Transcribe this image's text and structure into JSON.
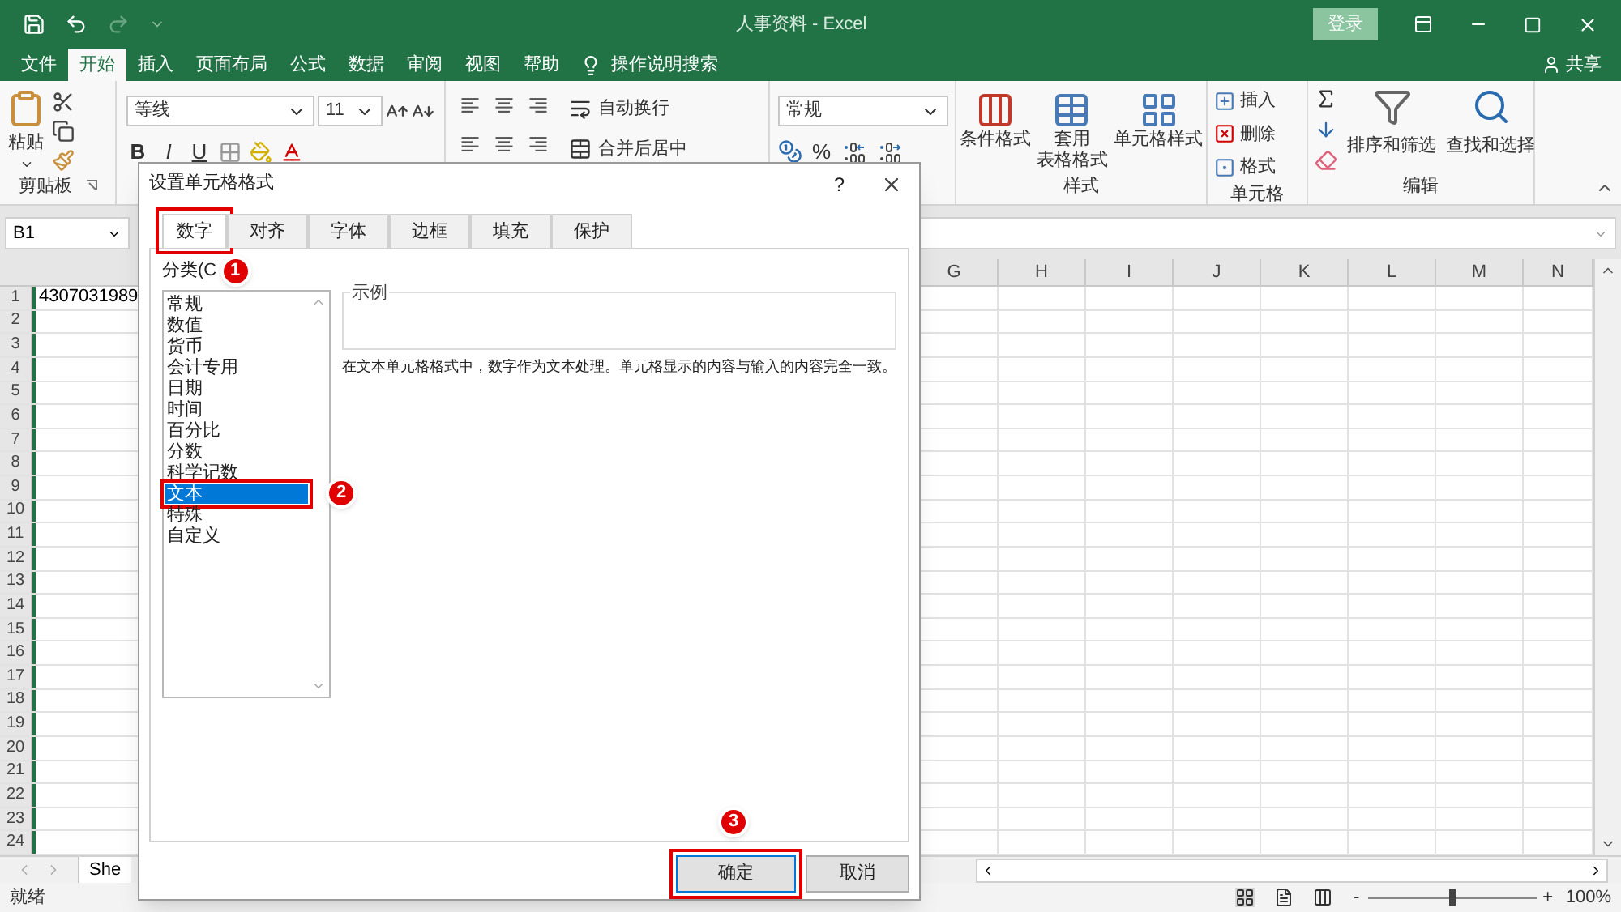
{
  "title_bar": {
    "title": "人事资料 - Excel",
    "sign_in": "登录"
  },
  "menu_tabs": [
    {
      "label": "文件",
      "selected": false
    },
    {
      "label": "开始",
      "selected": true
    },
    {
      "label": "插入",
      "selected": false
    },
    {
      "label": "页面布局",
      "selected": false
    },
    {
      "label": "公式",
      "selected": false
    },
    {
      "label": "数据",
      "selected": false
    },
    {
      "label": "审阅",
      "selected": false
    },
    {
      "label": "视图",
      "selected": false
    },
    {
      "label": "帮助",
      "selected": false
    }
  ],
  "tell_me": "操作说明搜索",
  "share": "共享",
  "ribbon": {
    "paste": "粘贴",
    "clipboard_label": "剪贴板",
    "font_name": "等线",
    "font_size": "11",
    "format_buttons": [
      "B",
      "I",
      "U"
    ],
    "wrap_text": "自动换行",
    "merge_center": "合并后居中",
    "number_format": "常规",
    "percent": "%",
    "styles": [
      {
        "lines": [
          "条件格式"
        ]
      },
      {
        "lines": [
          "套用",
          "表格格式"
        ]
      },
      {
        "lines": [
          "单元格样式"
        ]
      }
    ],
    "styles_label": "样式",
    "cells": [
      "插入",
      "删除",
      "格式"
    ],
    "cells_label": "单元格",
    "editing": [
      "排序和筛选",
      "查找和选择"
    ],
    "editing_label": "编辑"
  },
  "name_box": "B1",
  "columns": [
    "G",
    "H",
    "I",
    "J",
    "K",
    "L",
    "M",
    "N"
  ],
  "rows": [
    "1",
    "2",
    "3",
    "4",
    "5",
    "6",
    "7",
    "8",
    "9",
    "10",
    "11",
    "12",
    "13",
    "14",
    "15",
    "16",
    "17",
    "18",
    "19",
    "20",
    "21",
    "22",
    "23",
    "24"
  ],
  "cell_a1": "4307031989",
  "sheet_tab": "She",
  "status": "就绪",
  "zoom": {
    "minus": "-",
    "plus": "+",
    "level": 0.5,
    "reading": "100%"
  },
  "dialog": {
    "title": "设置单元格格式",
    "help": "?",
    "tabs": [
      {
        "label": "数字",
        "selected": true
      },
      {
        "label": "对齐",
        "selected": false
      },
      {
        "label": "字体",
        "selected": false
      },
      {
        "label": "边框",
        "selected": false
      },
      {
        "label": "填充",
        "selected": false
      },
      {
        "label": "保护",
        "selected": false
      }
    ],
    "category_label": "分类(C",
    "categories": [
      {
        "label": "常规",
        "selected": false
      },
      {
        "label": "数值",
        "selected": false
      },
      {
        "label": "货币",
        "selected": false
      },
      {
        "label": "会计专用",
        "selected": false
      },
      {
        "label": "日期",
        "selected": false
      },
      {
        "label": "时间",
        "selected": false
      },
      {
        "label": "百分比",
        "selected": false
      },
      {
        "label": "分数",
        "selected": false
      },
      {
        "label": "科学记数",
        "selected": false
      },
      {
        "label": "文本",
        "selected": true
      },
      {
        "label": "特殊",
        "selected": false
      },
      {
        "label": "自定义",
        "selected": false
      }
    ],
    "sample_label": "示例",
    "description": "在文本单元格格式中，数字作为文本处理。单元格显示的内容与输入的内容完全一致。",
    "buttons": [
      {
        "label": "确定",
        "kind": "primary"
      },
      {
        "label": "取消",
        "kind": "normal"
      }
    ]
  },
  "annotations": [
    {
      "label": "1"
    },
    {
      "label": "2"
    },
    {
      "label": "3"
    }
  ]
}
